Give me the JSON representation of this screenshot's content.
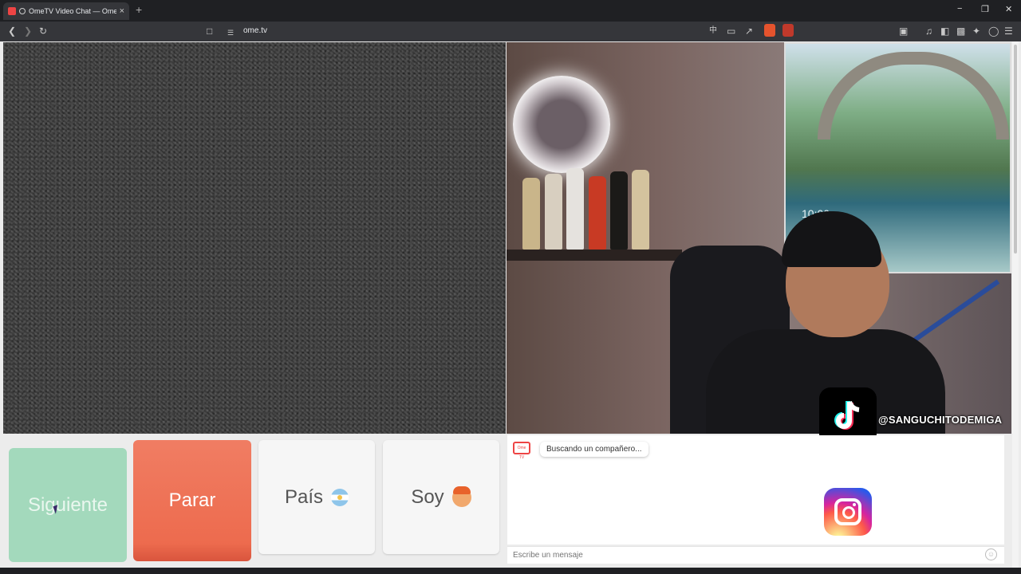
{
  "browser": {
    "tab_title": "OmeTV Video Chat — Omeg",
    "url": "ome.tv",
    "new_tab": "+",
    "tab_close": "×",
    "minimize": "−",
    "restore": "❐",
    "close": "✕"
  },
  "toolbar_icons": [
    "back-icon",
    "forward-icon",
    "reload-icon",
    "bookmark-icon",
    "site-info-icon",
    "translate-icon",
    "cast-icon",
    "share-icon",
    "brave-shields-icon",
    "brave-rewards-icon",
    "screenshot-icon",
    "media-icon",
    "sidebar-icon",
    "wallet-icon",
    "leo-icon",
    "vpn-icon",
    "menu-icon"
  ],
  "painting_clock": "10:00",
  "overlay": {
    "tiktok_handle": "@SANGUCHITODEMIGA"
  },
  "buttons": {
    "next": "Siguiente",
    "stop": "Parar",
    "country": "País",
    "gender": "Soy"
  },
  "chat": {
    "logo_text": "Ome TV",
    "status": "Buscando un compañero...",
    "placeholder": "Escribe un mensaje"
  },
  "colors": {
    "next_button": "#a3d9bc",
    "stop_button": "#ed6b4e",
    "neutral_button": "#f6f6f6"
  }
}
